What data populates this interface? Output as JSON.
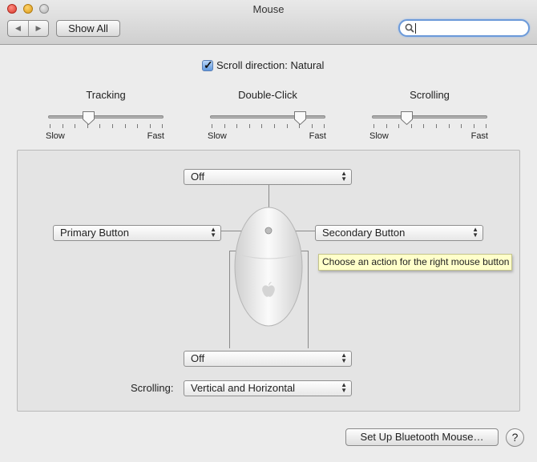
{
  "window": {
    "title": "Mouse"
  },
  "toolbar": {
    "show_all_label": "Show All",
    "back_icon": "back-arrow-icon",
    "forward_icon": "forward-arrow-icon"
  },
  "search": {
    "value": "",
    "placeholder": ""
  },
  "scroll_direction": {
    "label": "Scroll direction: Natural",
    "checked": true
  },
  "sliders": [
    {
      "title": "Tracking",
      "min_label": "Slow",
      "max_label": "Fast",
      "value_fraction": 0.35
    },
    {
      "title": "Double-Click",
      "min_label": "Slow",
      "max_label": "Fast",
      "value_fraction": 0.78
    },
    {
      "title": "Scrolling",
      "min_label": "Slow",
      "max_label": "Fast",
      "value_fraction": 0.3
    }
  ],
  "mouse_panel": {
    "top_action": "Off",
    "left_action": "Primary Button",
    "right_action": "Secondary Button",
    "bottom_action": "Off",
    "scrolling_label": "Scrolling:",
    "scrolling_value": "Vertical and Horizontal",
    "tooltip": "Choose an action for the right mouse button"
  },
  "footer": {
    "bluetooth_button": "Set Up Bluetooth Mouse…",
    "help_label": "?"
  }
}
